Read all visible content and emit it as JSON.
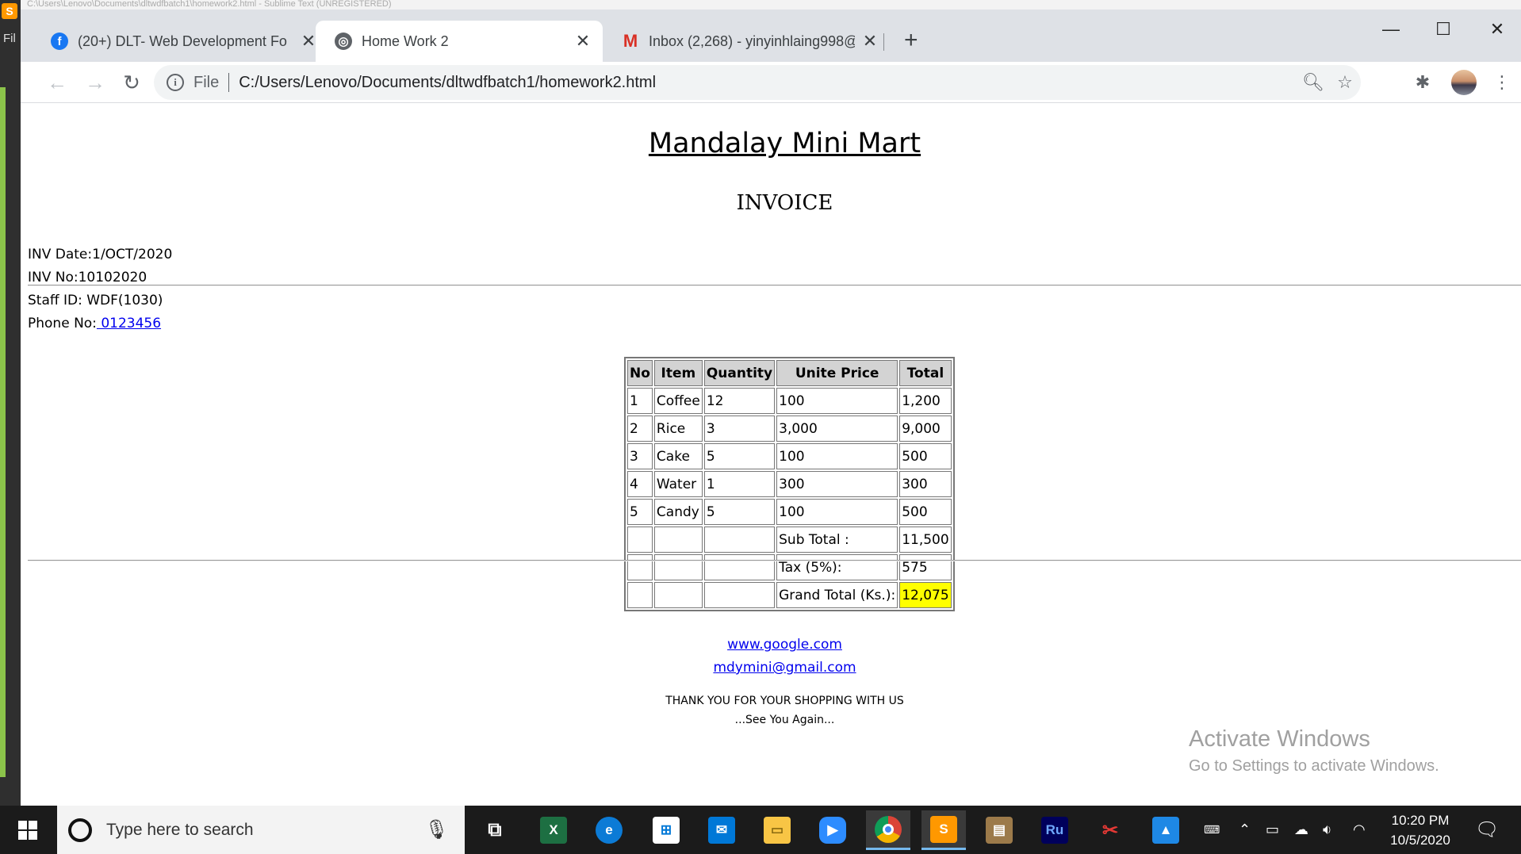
{
  "background_window": {
    "menu_label": "Fil",
    "title_fragment": "C:\\Users\\Lenovo\\Documents\\dltwdfbatch1\\homework2.html - Sublime Text (UNREGISTERED)"
  },
  "tabs": [
    {
      "icon": "facebook-icon",
      "label": "(20+) DLT- Web Development Fo",
      "active": false
    },
    {
      "icon": "globe-icon",
      "label": "Home Work 2",
      "active": true
    },
    {
      "icon": "gmail-icon",
      "label": "Inbox (2,268) - yinyinhlaing998@",
      "active": false
    }
  ],
  "toolbar": {
    "scheme_label": "File",
    "url": "C:/Users/Lenovo/Documents/dltwdfbatch1/homework2.html"
  },
  "page": {
    "title": "Mandalay Mini Mart",
    "heading": "INVOICE",
    "meta": {
      "date": "INV Date:1/OCT/2020",
      "number": "INV No:10102020",
      "staff": "Staff ID: WDF(1030)",
      "phone_label": "Phone No:",
      "phone_value": " 0123456"
    },
    "table": {
      "headers": [
        "No",
        "Item",
        "Quantity",
        "Unite Price",
        "Total"
      ],
      "rows": [
        [
          "1",
          "Coffee",
          "12",
          "100",
          "1,200"
        ],
        [
          "2",
          "Rice",
          "3",
          "3,000",
          "9,000"
        ],
        [
          "3",
          "Cake",
          "5",
          "100",
          "500"
        ],
        [
          "4",
          "Water",
          "1",
          "300",
          "300"
        ],
        [
          "5",
          "Candy",
          "5",
          "100",
          "500"
        ]
      ],
      "summary": [
        {
          "label": "Sub Total :",
          "value": "11,500"
        },
        {
          "label": "Tax (5%):",
          "value": "575"
        },
        {
          "label": "Grand Total (Ks.):",
          "value": "12,075"
        }
      ],
      "highlight_color": "#ffff00"
    },
    "footer": {
      "website": "www.google.com",
      "email": "mdymini@gmail.com",
      "thanks": "THANK YOU FOR YOUR SHOPPING WITH US",
      "see_you": "...See You Again..."
    }
  },
  "watermark": {
    "line1": "Activate Windows",
    "line2": "Go to Settings to activate Windows."
  },
  "taskbar": {
    "search_placeholder": "Type here to search",
    "apps": [
      "task-view",
      "excel",
      "edge",
      "microsoft-store",
      "mail",
      "file-explorer",
      "zoom",
      "chrome",
      "sublime-text",
      "winrar",
      "adobe-premiere-rush",
      "snipping-tool",
      "photos"
    ],
    "time": "10:20 PM",
    "date": "10/5/2020"
  }
}
